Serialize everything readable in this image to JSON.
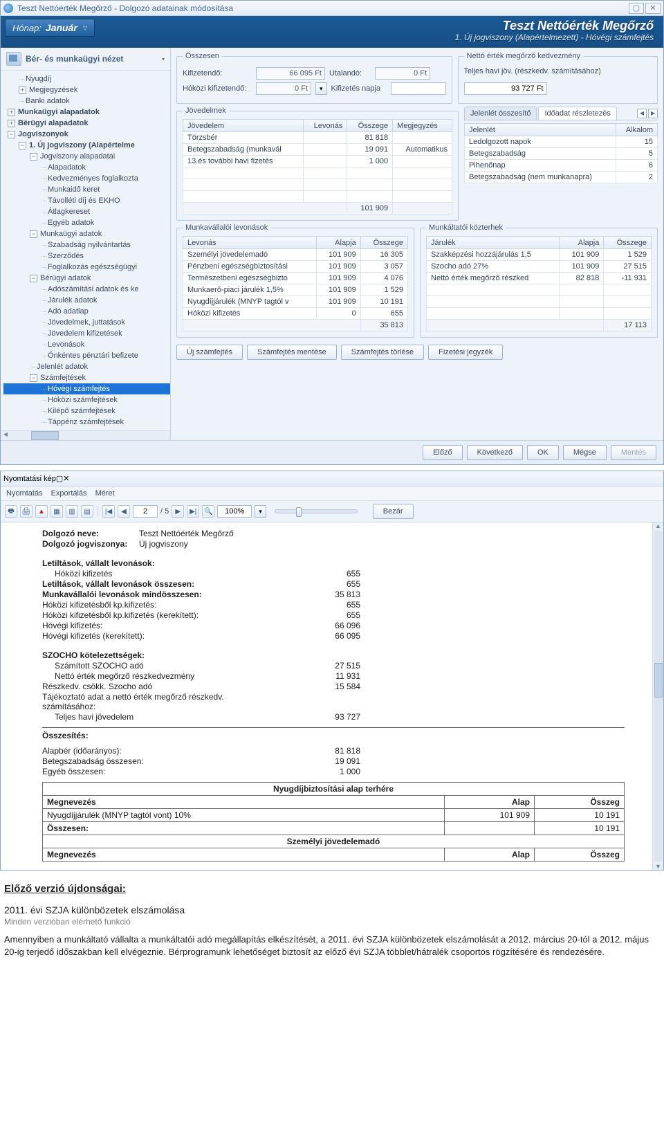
{
  "win1": {
    "title": "Teszt Nettóérték Megőrző - Dolgozó adatainak módosítása",
    "minimize_glyph": "▢",
    "close_glyph": "✕",
    "month_label": "Hónap:",
    "month_value": "Január",
    "app_name": "Teszt Nettóérték Megőrző",
    "app_sub": "1. Új jogviszony (Alapértelmezett) - Hóvégi számfejtés"
  },
  "sidebar": {
    "title": "Bér- és munkaügyi nézet",
    "tree": [
      {
        "ind": 1,
        "exp": "",
        "txt": "Nyugdíj"
      },
      {
        "ind": 1,
        "exp": "+",
        "txt": "Megjegyzések"
      },
      {
        "ind": 1,
        "exp": "",
        "txt": "Banki adatok"
      },
      {
        "ind": 0,
        "exp": "+",
        "txt": "Munkaügyi alapadatok",
        "bold": true
      },
      {
        "ind": 0,
        "exp": "+",
        "txt": "Bérügyi alapadatok",
        "bold": true
      },
      {
        "ind": 0,
        "exp": "-",
        "txt": "Jogviszonyok",
        "bold": true
      },
      {
        "ind": 1,
        "exp": "-",
        "txt": "1. Új jogviszony (Alapértelme",
        "bold": true
      },
      {
        "ind": 2,
        "exp": "-",
        "txt": "Jogviszony alapadatai"
      },
      {
        "ind": 3,
        "exp": "",
        "txt": "Alapadatok"
      },
      {
        "ind": 3,
        "exp": "",
        "txt": "Kedvezményes foglalkozta"
      },
      {
        "ind": 3,
        "exp": "",
        "txt": "Munkaidő keret"
      },
      {
        "ind": 3,
        "exp": "",
        "txt": "Távolléti díj és EKHO"
      },
      {
        "ind": 3,
        "exp": "",
        "txt": "Átlagkereset"
      },
      {
        "ind": 3,
        "exp": "",
        "txt": "Egyéb adatok"
      },
      {
        "ind": 2,
        "exp": "-",
        "txt": "Munkaügyi adatok"
      },
      {
        "ind": 3,
        "exp": "",
        "txt": "Szabadság nyilvántartás"
      },
      {
        "ind": 3,
        "exp": "",
        "txt": "Szerződés"
      },
      {
        "ind": 3,
        "exp": "",
        "txt": "Foglalkozás egészségügyi"
      },
      {
        "ind": 2,
        "exp": "-",
        "txt": "Bérügyi adatok"
      },
      {
        "ind": 3,
        "exp": "",
        "txt": "Adószámítási adatok és ke"
      },
      {
        "ind": 3,
        "exp": "",
        "txt": "Járulék adatok"
      },
      {
        "ind": 3,
        "exp": "",
        "txt": "Adó adatlap"
      },
      {
        "ind": 3,
        "exp": "",
        "txt": "Jövedelmek, juttatások"
      },
      {
        "ind": 3,
        "exp": "",
        "txt": "Jövedelem kifizetések"
      },
      {
        "ind": 3,
        "exp": "",
        "txt": "Levonások"
      },
      {
        "ind": 3,
        "exp": "",
        "txt": "Önkéntes pénztári befizete"
      },
      {
        "ind": 2,
        "exp": "",
        "txt": "Jelenlét adatok"
      },
      {
        "ind": 2,
        "exp": "-",
        "txt": "Számfejtések"
      },
      {
        "ind": 3,
        "exp": "",
        "txt": "Hóvégi számfejtés",
        "sel": true
      },
      {
        "ind": 3,
        "exp": "",
        "txt": "Hóközi számfejtések"
      },
      {
        "ind": 3,
        "exp": "",
        "txt": "Kilépő számfejtések"
      },
      {
        "ind": 3,
        "exp": "",
        "txt": "Táppénz számfejtések"
      }
    ]
  },
  "osszesen": {
    "legend": "Összesen",
    "kif_lbl": "Kifizetendő:",
    "kif_val": "66 095 Ft",
    "utal_lbl": "Utalandó:",
    "utal_val": "0 Ft",
    "hokozi_lbl": "Hóközi kifizetendő:",
    "hokozi_val": "0 Ft",
    "kifnap_lbl": "Kifizetés napja",
    "drop": "▾"
  },
  "nettokedv": {
    "legend": "Nettó érték megőrző kedvezmény",
    "teljes_lbl": "Teljes havi jöv. (részkedv. számításához)",
    "teljes_val": "93 727 Ft"
  },
  "jovedelmek": {
    "legend": "Jövedelmek",
    "cols": [
      "Jövedelem",
      "Levonás",
      "Összege",
      "Megjegyzés"
    ],
    "rows": [
      [
        "Törzsbér",
        "",
        "81 818",
        ""
      ],
      [
        "Betegszabadság (munkavál",
        "",
        "19 091",
        "Automatikus"
      ],
      [
        "13.és további havi fizetés",
        "",
        "1 000",
        ""
      ]
    ],
    "total": "101 909"
  },
  "attend": {
    "tab1": "Jelenlét összesítő",
    "tab2": "Időadat részletezés",
    "cols": [
      "Jelenlét",
      "Alkalom"
    ],
    "rows": [
      [
        "Ledolgozott napok",
        "15"
      ],
      [
        "Betegszabadság",
        "5"
      ],
      [
        "Pihenőnap",
        "6"
      ],
      [
        "Betegszabadság (nem munkanapra)",
        "2"
      ]
    ]
  },
  "lev": {
    "legend": "Munkavállalói levonások",
    "cols": [
      "Levonás",
      "Alapja",
      "Összege"
    ],
    "rows": [
      [
        "Személyi jövedelemadó",
        "101 909",
        "16 305"
      ],
      [
        "Pénzbeni egészségbiztosítási",
        "101 909",
        "3 057"
      ],
      [
        "Természetbeni egészségbizto",
        "101 909",
        "4 076"
      ],
      [
        "Munkaerő-piaci járulék 1,5%",
        "101 909",
        "1 529"
      ],
      [
        "Nyugdíjjárulék (MNYP tagtól v",
        "101 909",
        "10 191"
      ],
      [
        "Hóközi kifizetés",
        "0",
        "655"
      ]
    ],
    "total": "35 813"
  },
  "koz": {
    "legend": "Munkáltatói közterhek",
    "cols": [
      "Járulék",
      "Alapja",
      "Összege"
    ],
    "rows": [
      [
        "Szakképzési hozzájárulás 1,5",
        "101 909",
        "1 529"
      ],
      [
        "Szocho adó 27%",
        "101 909",
        "27 515"
      ],
      [
        "Nettó érték megőrző részked",
        "82 818",
        "-11 931"
      ]
    ],
    "total": "17 113"
  },
  "actions": {
    "uj": "Új számfejtés",
    "ment": "Számfejtés mentése",
    "torl": "Számfejtés törlése",
    "jegyz": "Fizetési jegyzék"
  },
  "footer_btns": {
    "elozo": "Előző",
    "kov": "Következő",
    "ok": "OK",
    "megse": "Mégse",
    "mentes": "Mentés"
  },
  "win2": {
    "title": "Nyomtatási kép",
    "menu": [
      "Nyomtatás",
      "Exportálás",
      "Méret"
    ],
    "page_cur": "2",
    "page_total": "/ 5",
    "zoom": "100%",
    "close": "Bezár"
  },
  "pv": {
    "name_lbl": "Dolgozó neve:",
    "name_val": "Teszt Nettóérték Megőrző",
    "jogv_lbl": "Dolgozó jogviszonya:",
    "jogv_val": "Új jogviszony",
    "sec1": "Letiltások, vállalt levonások:",
    "r1": {
      "lbl": "Hóközi kifizetés",
      "val": "655"
    },
    "r2": {
      "lbl": "Letiltások, vállalt levonások összesen:",
      "val": "655",
      "bold": true
    },
    "r3": {
      "lbl": "Munkavállalói levonások mindösszesen:",
      "val": "35 813",
      "bold": true
    },
    "r4": {
      "lbl": "Hóközi kifizetésből kp.kifizetés:",
      "val": "655"
    },
    "r5": {
      "lbl": "Hóközi kifizetésből kp.kifizetés (kerekített):",
      "val": "655"
    },
    "r6": {
      "lbl": "Hóvégi kifizetés:",
      "val": "66 096"
    },
    "r7": {
      "lbl": "Hóvégi kifizetés (kerekített):",
      "val": "66 095"
    },
    "sec2": "SZOCHO kötelezettségek:",
    "s1": {
      "lbl": "Számított SZOCHO adó",
      "val": "27 515"
    },
    "s2": {
      "lbl": "Nettó érték megőrző részkedvezmény",
      "val": "11 931"
    },
    "s3": {
      "lbl": "Részkedv. csökk. Szocho adó",
      "val": "15 584"
    },
    "s4": {
      "lbl": "Tájékoztató adat a nettó érték megőrző részkedv. számításához:",
      "val": ""
    },
    "s5": {
      "lbl": "Teljes havi jövedelem",
      "val": "93 727"
    },
    "sec3": "Összesítés:",
    "o1": {
      "lbl": "Alapbér (időarányos):",
      "val": "81 818"
    },
    "o2": {
      "lbl": "Betegszabadság összesen:",
      "val": "19 091"
    },
    "o3": {
      "lbl": "Egyéb összesen:",
      "val": "1 000"
    },
    "tbl1_title": "Nyugdíjbiztosítási alap terhére",
    "tbl_cols": [
      "Megnevezés",
      "Alap",
      "Összeg"
    ],
    "tbl1_row": [
      "Nyugdíjjárulék (MNYP tagtól vont) 10%",
      "101 909",
      "10 191"
    ],
    "tbl1_sum": [
      "Összesen:",
      "",
      "10 191"
    ],
    "tbl2_title": "Személyi jövedelemadó"
  },
  "notes": {
    "h3": "Előző verzió újdonságai:",
    "h4": "2011. évi SZJA különbözetek elszámolása",
    "grey": "Minden verzióban elérhető funkció",
    "p": "Amennyiben a munkáltató vállalta a munkáltatói adó megállapítás elkészítését, a 2011. évi SZJA különbözetek elszámolását a 2012. március 20-tól a 2012. május 20-ig terjedő időszakban kell elvégeznie. Bérprogramunk lehetőséget biztosít az előző évi SZJA többlet/hátralék csoportos rögzítésére és rendezésére."
  }
}
